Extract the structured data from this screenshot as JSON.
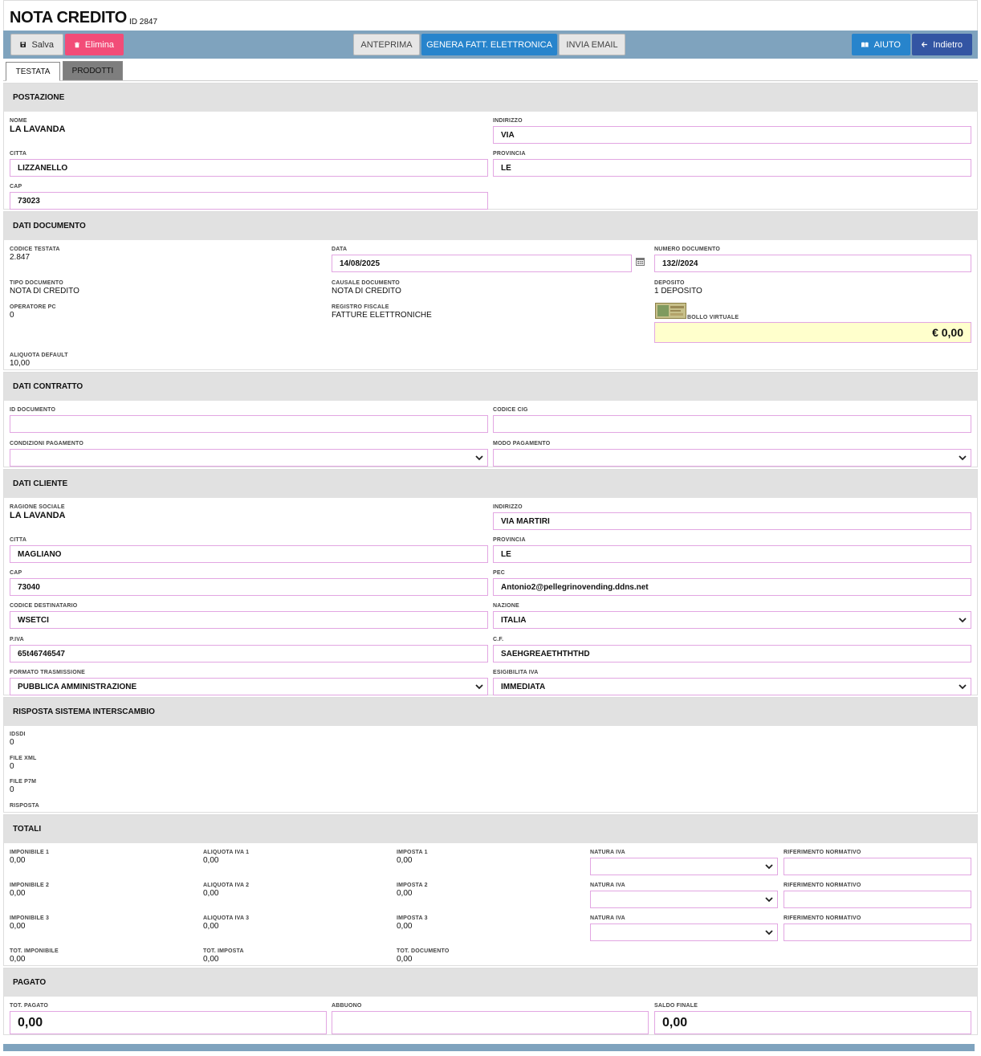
{
  "header": {
    "title": "NOTA CREDITO",
    "id_label": "ID 2847"
  },
  "toolbar": {
    "save": "Salva",
    "delete": "Elimina",
    "preview": "ANTEPRIMA",
    "generate": "GENERA FATT. ELETTRONICA",
    "email": "INVIA EMAIL",
    "help": "AIUTO",
    "back": "Indietro",
    "colors": {
      "bar": "#7fa3be",
      "delete": "#f24c78",
      "primary": "#2784cc",
      "dark": "#3355a3"
    }
  },
  "tabs": [
    "TESTATA",
    "PRODOTTI"
  ],
  "postazione": {
    "title": "POSTAZIONE",
    "nome_label": "NOME",
    "nome": "LA LAVANDA",
    "indirizzo_label": "INDIRIZZO",
    "indirizzo": "VIA",
    "citta_label": "CITTA",
    "citta": "LIZZANELLO",
    "provincia_label": "PROVINCIA",
    "provincia": "LE",
    "cap_label": "CAP",
    "cap": "73023"
  },
  "dati_documento": {
    "title": "DATI DOCUMENTO",
    "codice_testata_label": "CODICE TESTATA",
    "codice_testata": "2.847",
    "data_label": "DATA",
    "data": "14/08/2025",
    "numero_label": "NUMERO DOCUMENTO",
    "numero": "132//2024",
    "tipo_label": "TIPO DOCUMENTO",
    "tipo": "NOTA DI CREDITO",
    "causale_label": "CAUSALE DOCUMENTO",
    "causale": "NOTA DI CREDITO",
    "deposito_label": "DEPOSITO",
    "deposito": "1 DEPOSITO",
    "operatore_label": "OPERATORE PC",
    "operatore": "0",
    "registro_label": "REGISTRO FISCALE",
    "registro": "FATTURE ELETTRONICHE",
    "bollo_label": "BOLLO VIRTUALE",
    "bollo": "€ 0,00",
    "aliquota_label": "ALIQUOTA DEFAULT",
    "aliquota": "10,00",
    "bollo_color": "#ffffcc"
  },
  "dati_contratto": {
    "title": "DATI CONTRATTO",
    "id_doc_label": "ID DOCUMENTO",
    "id_doc": "",
    "cig_label": "CODICE CIG",
    "cig": "",
    "condizioni_label": "CONDIZIONI PAGAMENTO",
    "condizioni": "",
    "modo_label": "MODO PAGAMENTO",
    "modo": ""
  },
  "dati_cliente": {
    "title": "DATI CLIENTE",
    "ragione_label": "RAGIONE SOCIALE",
    "ragione": "LA LAVANDA",
    "indirizzo_label": "INDIRIZZO",
    "indirizzo": "VIA MARTIRI",
    "citta_label": "CITTA",
    "citta": "MAGLIANO",
    "provincia_label": "PROVINCIA",
    "provincia": "LE",
    "cap_label": "CAP",
    "cap": "73040",
    "pec_label": "PEC",
    "pec": "Antonio2@pellegrinovending.ddns.net",
    "coddest_label": "CODICE DESTINATARIO",
    "coddest": "WSETCI",
    "nazione_label": "NAZIONE",
    "nazione": "ITALIA",
    "piva_label": "P.IVA",
    "piva": "65t46746547",
    "cf_label": "C.F.",
    "cf": "SAEHGREAETHTHTHD",
    "formato_label": "FORMATO TRASMISSIONE",
    "formato": "PUBBLICA AMMINISTRAZIONE",
    "esigibilita_label": "ESIGIBILITA IVA",
    "esigibilita": "IMMEDIATA"
  },
  "sdi": {
    "title": "RISPOSTA SISTEMA INTERSCAMBIO",
    "idsdi_label": "IDSDI",
    "idsdi": "0",
    "xml_label": "FILE XML",
    "xml": "0",
    "p7m_label": "FILE P7M",
    "p7m": "0",
    "risposta_label": "RISPOSTA"
  },
  "totali": {
    "title": "TOTALI",
    "imp1_label": "IMPONIBILE 1",
    "imp1": "0,00",
    "aliq1_label": "ALIQUOTA IVA 1",
    "aliq1": "0,00",
    "imposta1_label": "IMPOSTA 1",
    "imposta1": "0,00",
    "imp2_label": "IMPONIBILE 2",
    "imp2": "0,00",
    "aliq2_label": "ALIQUOTA IVA 2",
    "aliq2": "0,00",
    "imposta2_label": "IMPOSTA 2",
    "imposta2": "0,00",
    "imp3_label": "IMPONIBILE 3",
    "imp3": "0,00",
    "aliq3_label": "ALIQUOTA IVA 3",
    "aliq3": "0,00",
    "imposta3_label": "IMPOSTA 3",
    "imposta3": "0,00",
    "natura_label": "NATURA IVA",
    "rif_label": "RIFERIMENTO NORMATIVO",
    "tot_imp_label": "TOT. IMPONIBILE",
    "tot_imp": "0,00",
    "tot_imposta_label": "TOT. IMPOSTA",
    "tot_imposta": "0,00",
    "tot_doc_label": "TOT. DOCUMENTO",
    "tot_doc": "0,00"
  },
  "pagato": {
    "title": "PAGATO",
    "tot_pagato_label": "TOT. PAGATO",
    "tot_pagato": "0,00",
    "abbuono_label": "ABBUONO",
    "abbuono": "",
    "saldo_label": "SALDO FINALE",
    "saldo": "0,00"
  }
}
